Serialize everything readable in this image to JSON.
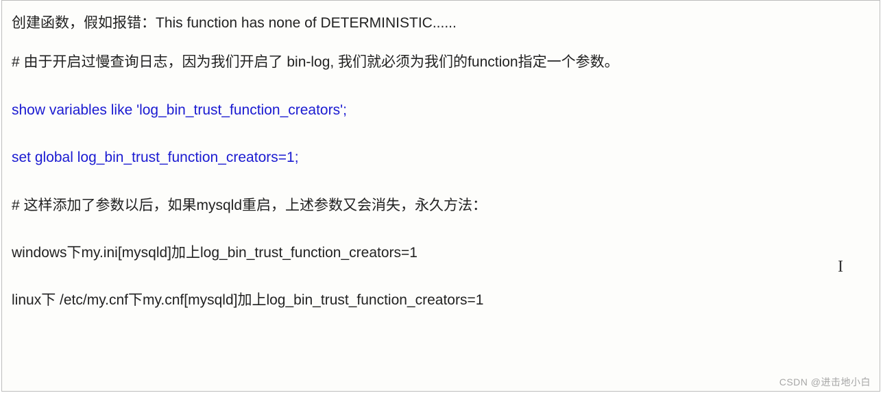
{
  "lines": {
    "l1": "创建函数，假如报错：This function has none of DETERMINISTIC......",
    "l2": "# 由于开启过慢查询日志，因为我们开启了 bin-log, 我们就必须为我们的function指定一个参数。",
    "l3": "show variables like 'log_bin_trust_function_creators';",
    "l4": "set global log_bin_trust_function_creators=1;",
    "l5": "# 这样添加了参数以后，如果mysqld重启，上述参数又会消失，永久方法：",
    "l6": "windows下my.ini[mysqld]加上log_bin_trust_function_creators=1",
    "l7": "linux下   /etc/my.cnf下my.cnf[mysqld]加上log_bin_trust_function_creators=1"
  },
  "watermark": "CSDN @进击地小白",
  "cursor_glyph": "I"
}
